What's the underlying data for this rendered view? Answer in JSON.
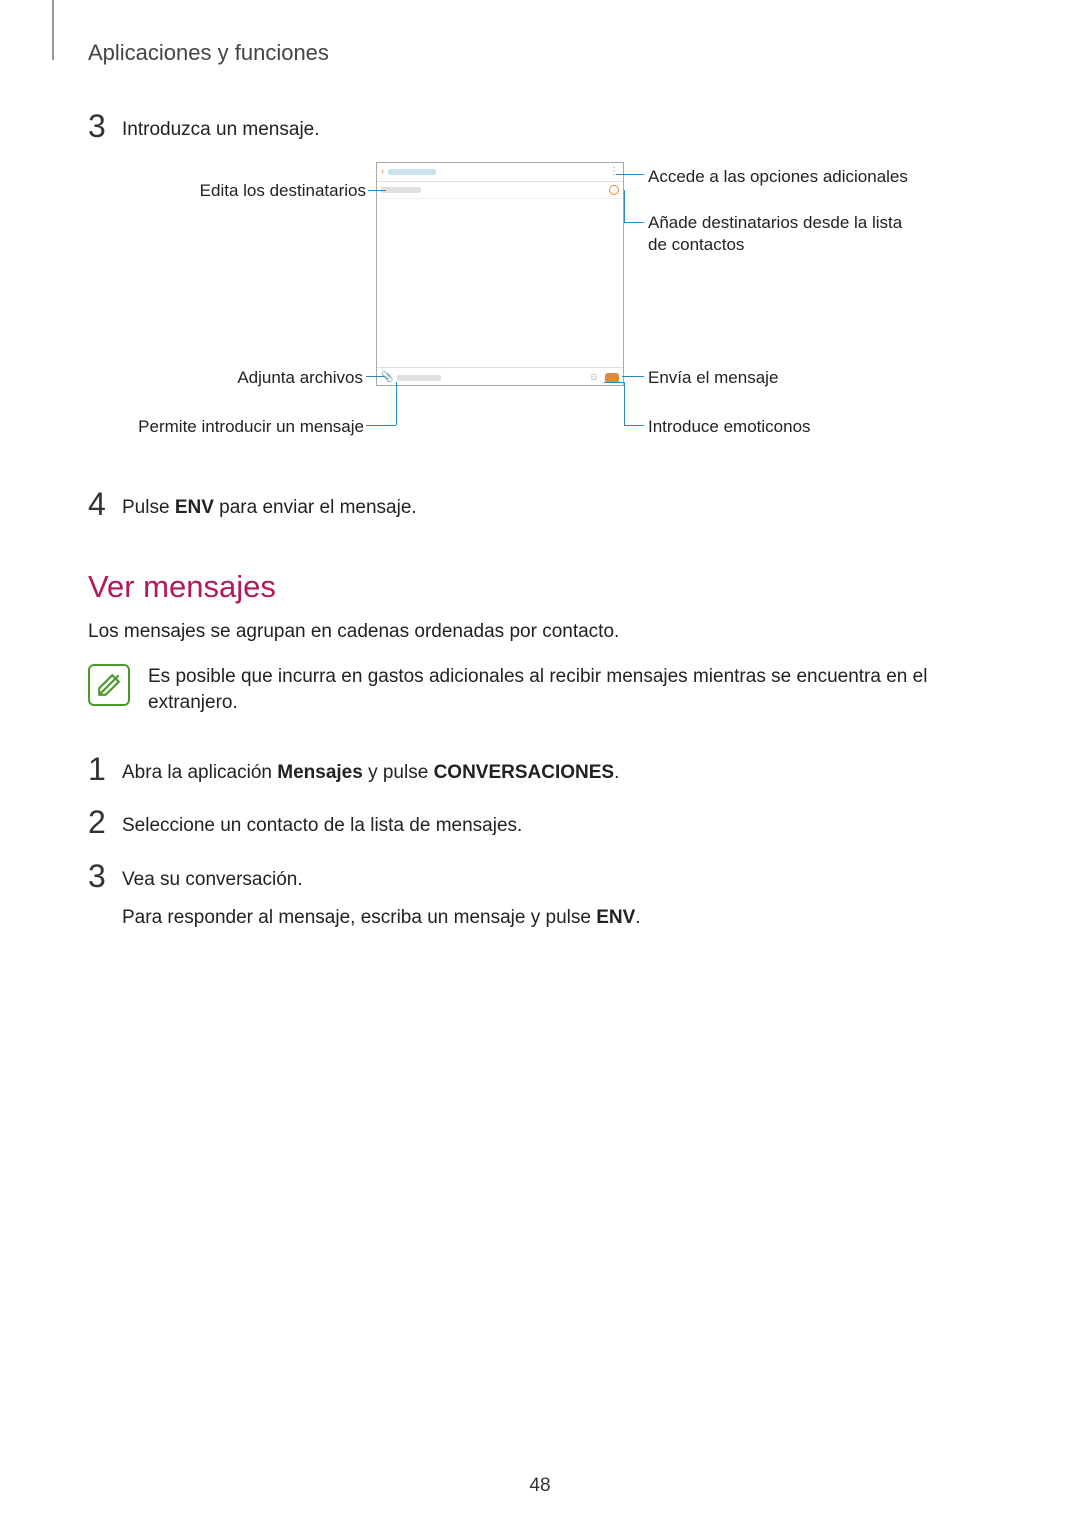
{
  "header": "Aplicaciones y funciones",
  "step3": {
    "num": "3",
    "text": "Introduzca un mensaje."
  },
  "callouts": {
    "left1": "Edita los destinatarios",
    "left2": "Adjunta archivos",
    "left3": "Permite introducir un mensaje",
    "right1": "Accede a las opciones adicionales",
    "right2a": "Añade destinatarios desde la lista",
    "right2b": "de contactos",
    "right3": "Envía el mensaje",
    "right4": "Introduce emoticonos"
  },
  "step4": {
    "num": "4",
    "pre": "Pulse ",
    "bold": "ENV",
    "post": " para enviar el mensaje."
  },
  "section": "Ver mensajes",
  "intro": "Los mensajes se agrupan en cadenas ordenadas por contacto.",
  "note": "Es posible que incurra en gastos adicionales al recibir mensajes mientras se encuentra en el extranjero.",
  "s1": {
    "num": "1",
    "pre": "Abra la aplicación ",
    "b1": "Mensajes",
    "mid": " y pulse ",
    "b2": "CONVERSACIONES",
    "post": "."
  },
  "s2": {
    "num": "2",
    "text": "Seleccione un contacto de la lista de mensajes."
  },
  "s3": {
    "num": "3",
    "line1": "Vea su conversación.",
    "line2pre": "Para responder al mensaje, escriba un mensaje y pulse ",
    "line2b": "ENV",
    "line2post": "."
  },
  "pagenum": "48"
}
